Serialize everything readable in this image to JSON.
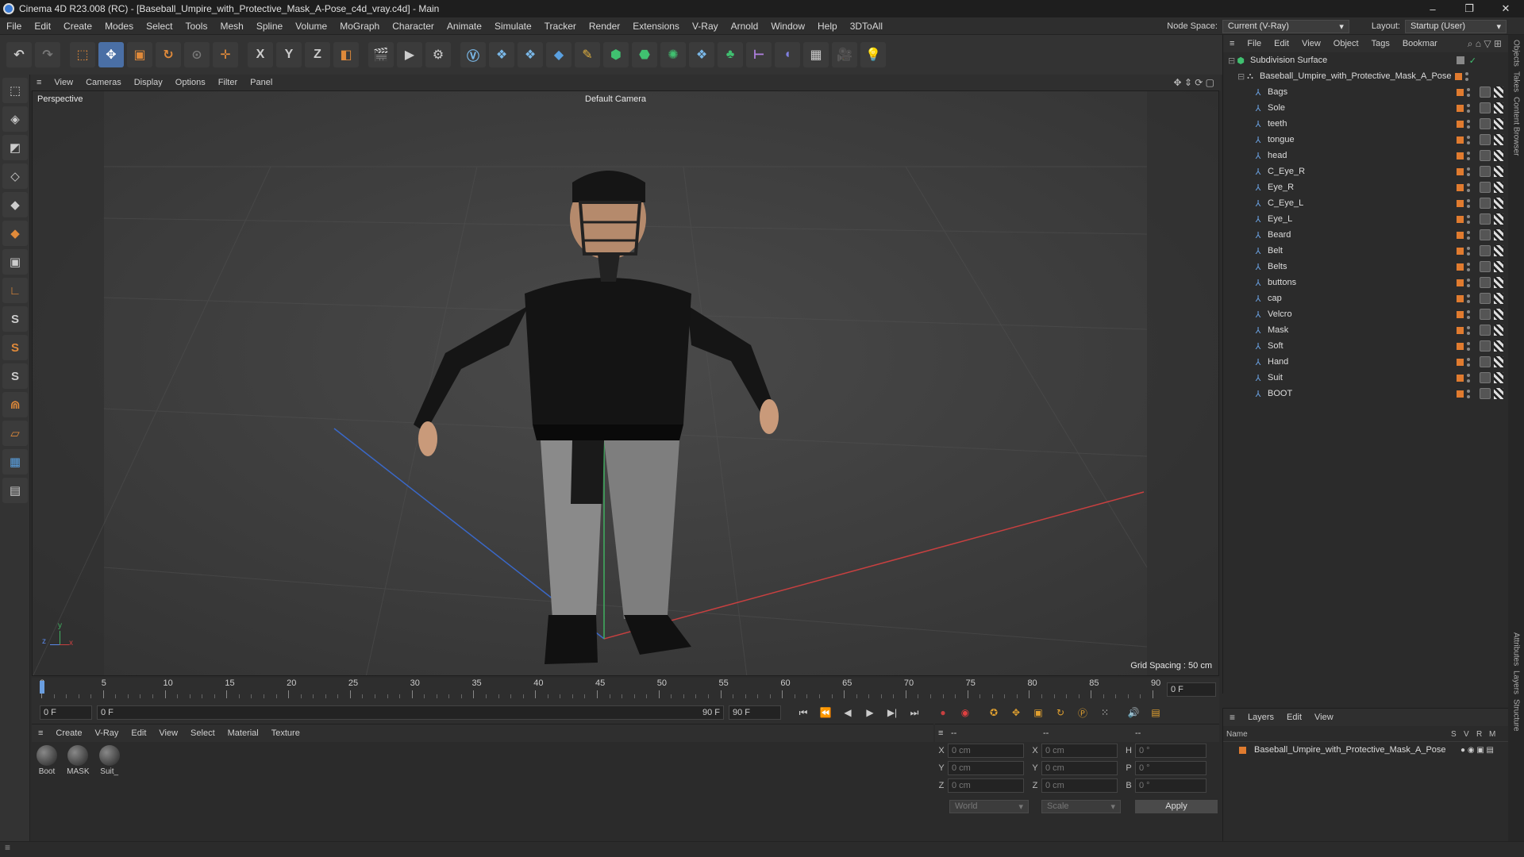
{
  "window": {
    "title": "Cinema 4D R23.008 (RC) - [Baseball_Umpire_with_Protective_Mask_A-Pose_c4d_vray.c4d] - Main",
    "controls": [
      "–",
      "❐",
      "✕"
    ]
  },
  "menubar": {
    "items": [
      "File",
      "Edit",
      "Create",
      "Modes",
      "Select",
      "Tools",
      "Mesh",
      "Spline",
      "Volume",
      "MoGraph",
      "Character",
      "Animate",
      "Simulate",
      "Tracker",
      "Render",
      "Extensions",
      "V-Ray",
      "Arnold",
      "Window",
      "Help",
      "3DToAll"
    ],
    "node_space_label": "Node Space:",
    "node_space_value": "Current (V-Ray)",
    "layout_label": "Layout:",
    "layout_value": "Startup (User)"
  },
  "toolbar": {
    "axis_x": "X",
    "axis_y": "Y",
    "axis_z": "Z"
  },
  "left_tools": {
    "s1": "S",
    "s2": "S",
    "s3": "S"
  },
  "viewport": {
    "menu": [
      "View",
      "Cameras",
      "Display",
      "Options",
      "Filter",
      "Panel"
    ],
    "label": "Perspective",
    "camera": "Default Camera",
    "grid_spacing": "Grid Spacing : 50 cm",
    "axis_y": "y",
    "axis_z": "z",
    "axis_x": "x"
  },
  "timeline": {
    "ticks": [
      "0",
      "5",
      "10",
      "15",
      "20",
      "25",
      "30",
      "35",
      "40",
      "45",
      "50",
      "55",
      "60",
      "65",
      "70",
      "75",
      "80",
      "85",
      "90"
    ],
    "frame_field": "0 F"
  },
  "transport": {
    "start": "0 F",
    "range_start": "0 F",
    "range_end": "90 F",
    "end": "90 F"
  },
  "material_panel": {
    "menu": [
      "Create",
      "V-Ray",
      "Edit",
      "View",
      "Select",
      "Material",
      "Texture"
    ],
    "materials": [
      "Boot",
      "MASK",
      "Suit_"
    ]
  },
  "coords": {
    "header_a": "--",
    "header_b": "--",
    "header_c": "--",
    "rows": [
      {
        "a": "X",
        "av": "0 cm",
        "b": "X",
        "bv": "0 cm",
        "c": "H",
        "cv": "0 °"
      },
      {
        "a": "Y",
        "av": "0 cm",
        "b": "Y",
        "bv": "0 cm",
        "c": "P",
        "cv": "0 °"
      },
      {
        "a": "Z",
        "av": "0 cm",
        "b": "Z",
        "bv": "0 cm",
        "c": "B",
        "cv": "0 °"
      }
    ],
    "mode": "World",
    "scale": "Scale",
    "apply": "Apply"
  },
  "objects": {
    "menu": [
      "File",
      "Edit",
      "View",
      "Object",
      "Tags",
      "Bookmar"
    ],
    "root": "Subdivision Surface",
    "group": "Baseball_Umpire_with_Protective_Mask_A_Pose",
    "items": [
      "Bags",
      "Sole",
      "teeth",
      "tongue",
      "head",
      "C_Eye_R",
      "Eye_R",
      "C_Eye_L",
      "Eye_L",
      "Beard",
      "Belt",
      "Belts",
      "buttons",
      "cap",
      "Velcro",
      "Mask",
      "Soft",
      "Hand",
      "Suit",
      "BOOT"
    ]
  },
  "layers": {
    "menu": [
      "Layers",
      "Edit",
      "View"
    ],
    "col_name": "Name",
    "cols": [
      "S",
      "V",
      "R",
      "M"
    ],
    "item": "Baseball_Umpire_with_Protective_Mask_A_Pose"
  },
  "side_tabs": [
    "Objects",
    "Takes",
    "Content Browser",
    "Attributes",
    "Layers",
    "Structure"
  ],
  "colors": {
    "accent_orange": "#e07b2f",
    "axis_red": "#c84040",
    "axis_blue": "#3a68c8",
    "axis_green": "#40b060"
  }
}
